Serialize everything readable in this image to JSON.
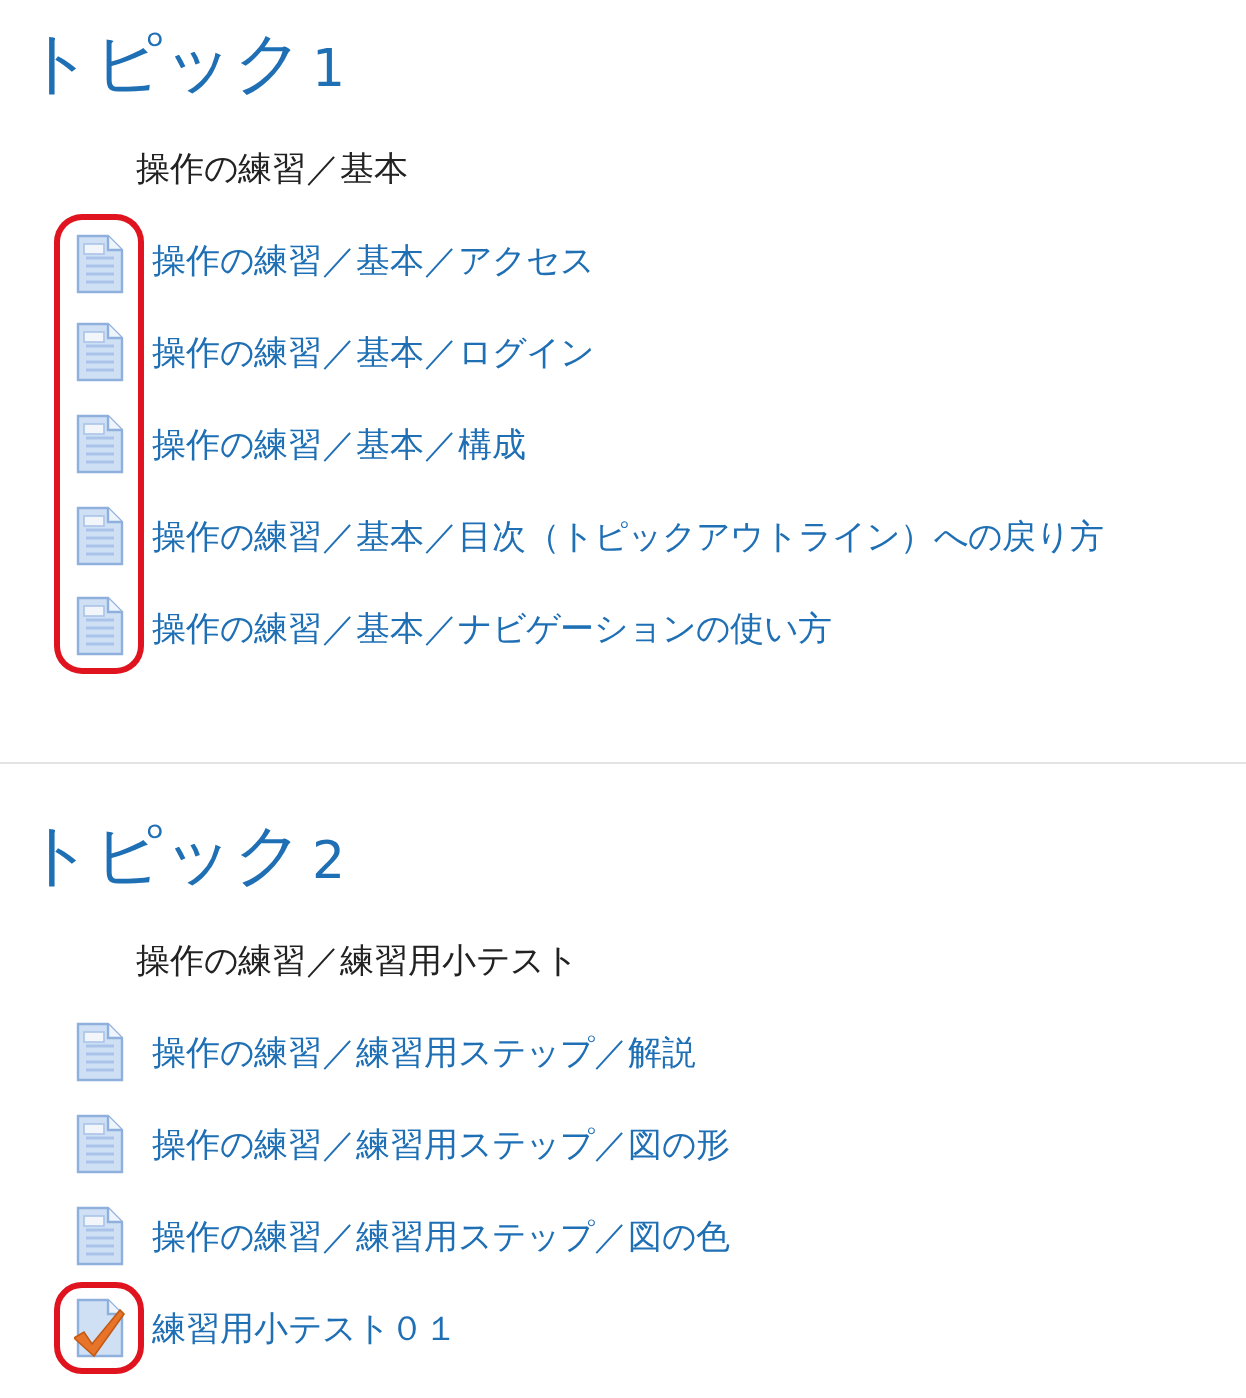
{
  "topics": [
    {
      "title": "トピック",
      "number": "1",
      "summary": "操作の練習／基本",
      "items": [
        {
          "kind": "page",
          "label": "操作の練習／基本／アクセス",
          "circled": true
        },
        {
          "kind": "page",
          "label": "操作の練習／基本／ログイン",
          "circled": true
        },
        {
          "kind": "page",
          "label": "操作の練習／基本／構成",
          "circled": true
        },
        {
          "kind": "page",
          "label": "操作の練習／基本／目次（トピックアウトライン）への戻り方",
          "circled": true
        },
        {
          "kind": "page",
          "label": "操作の練習／基本／ナビゲーションの使い方",
          "circled": true
        }
      ]
    },
    {
      "title": "トピック",
      "number": "2",
      "summary": "操作の練習／練習用小テスト",
      "items": [
        {
          "kind": "page",
          "label": "操作の練習／練習用ステップ／解説",
          "circled": false
        },
        {
          "kind": "page",
          "label": "操作の練習／練習用ステップ／図の形",
          "circled": false
        },
        {
          "kind": "page",
          "label": "操作の練習／練習用ステップ／図の色",
          "circled": false
        },
        {
          "kind": "quiz",
          "label": "練習用小テスト０１",
          "circled": true
        }
      ]
    }
  ]
}
